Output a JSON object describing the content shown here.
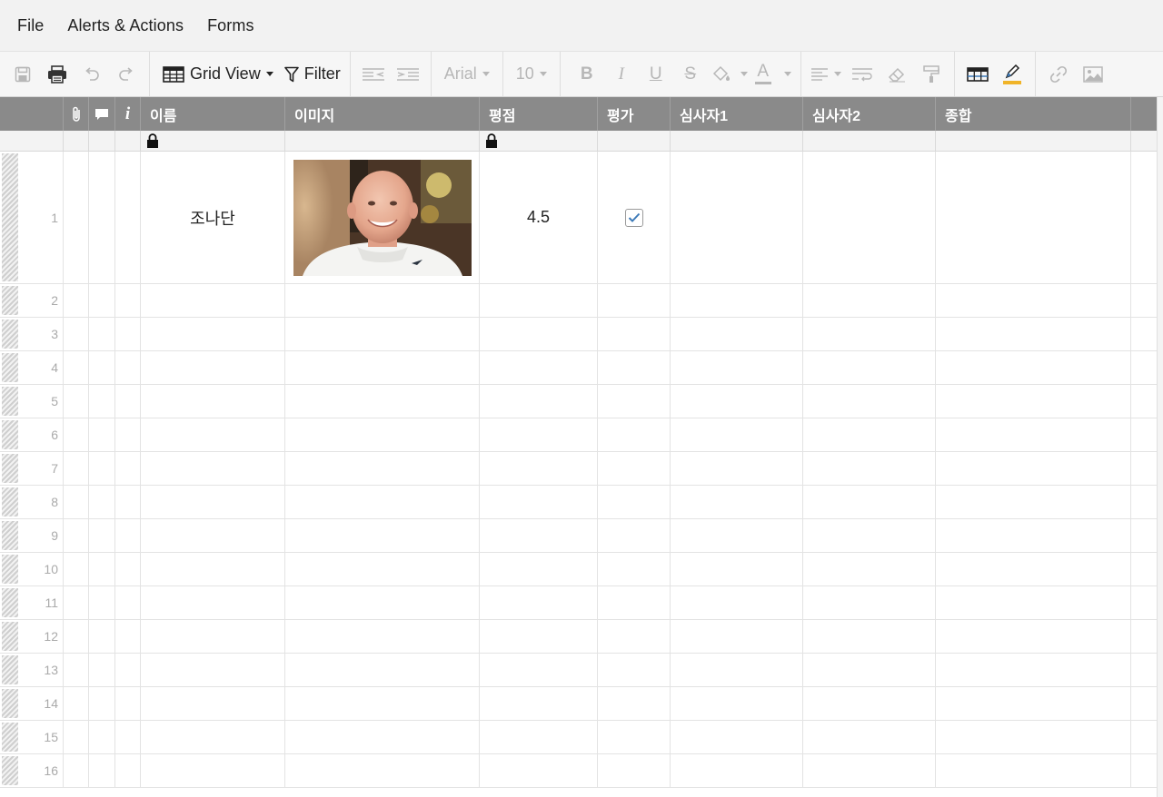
{
  "menu": {
    "items": [
      "File",
      "Alerts & Actions",
      "Forms"
    ]
  },
  "toolbar": {
    "grid_view_label": "Grid View",
    "filter_label": "Filter",
    "font_family": "Arial",
    "font_size": "10",
    "bold_label": "B",
    "italic_label": "I",
    "underline_label": "U",
    "strike_label": "S",
    "text_color_label": "A",
    "highlight_color": "#f0b429"
  },
  "grid": {
    "columns": [
      "이름",
      "이미지",
      "평점",
      "평가",
      "심사자1",
      "심사자2",
      "종합"
    ],
    "rows": [
      {
        "num": "1",
        "name": "조나단",
        "score": "4.5",
        "eval_checked": true
      },
      {
        "num": "2"
      },
      {
        "num": "3"
      },
      {
        "num": "4"
      },
      {
        "num": "5"
      },
      {
        "num": "6"
      },
      {
        "num": "7"
      },
      {
        "num": "8"
      },
      {
        "num": "9"
      },
      {
        "num": "10"
      },
      {
        "num": "11"
      },
      {
        "num": "12"
      },
      {
        "num": "13"
      },
      {
        "num": "14"
      },
      {
        "num": "15"
      },
      {
        "num": "16"
      }
    ]
  },
  "colors": {
    "header_bg": "#8a8a8a",
    "check_color": "#3d7ab8"
  }
}
